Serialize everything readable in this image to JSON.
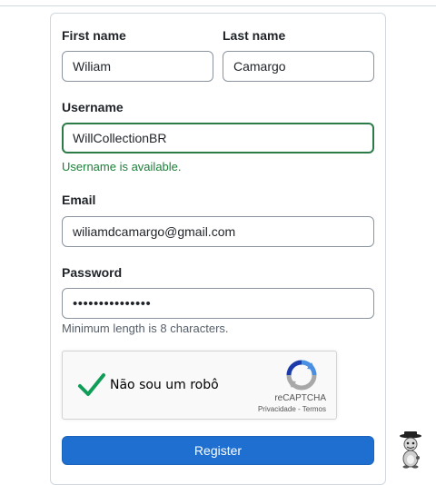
{
  "form": {
    "first_name": {
      "label": "First name",
      "value": "Wiliam"
    },
    "last_name": {
      "label": "Last name",
      "value": "Camargo"
    },
    "username": {
      "label": "Username",
      "value": "WillCollectionBR",
      "status": "Username is available."
    },
    "email": {
      "label": "Email",
      "value": "wiliamdcamargo@gmail.com"
    },
    "password": {
      "label": "Password",
      "value": "•••••••••••••••",
      "hint": "Minimum length is 8 characters."
    },
    "recaptcha": {
      "label": "Não sou um robô",
      "checked": true,
      "brand": "reCAPTCHA",
      "privacy": "Privacidade",
      "separator": "-",
      "terms": "Termos"
    },
    "register_label": "Register"
  },
  "colors": {
    "accent": "#1f6fd0",
    "success": "#1a7f37",
    "valid_border": "#2c7a48",
    "check": "#109d58"
  },
  "icons": [
    "checkmark-icon",
    "recaptcha-logo-icon",
    "mascot-icon"
  ]
}
